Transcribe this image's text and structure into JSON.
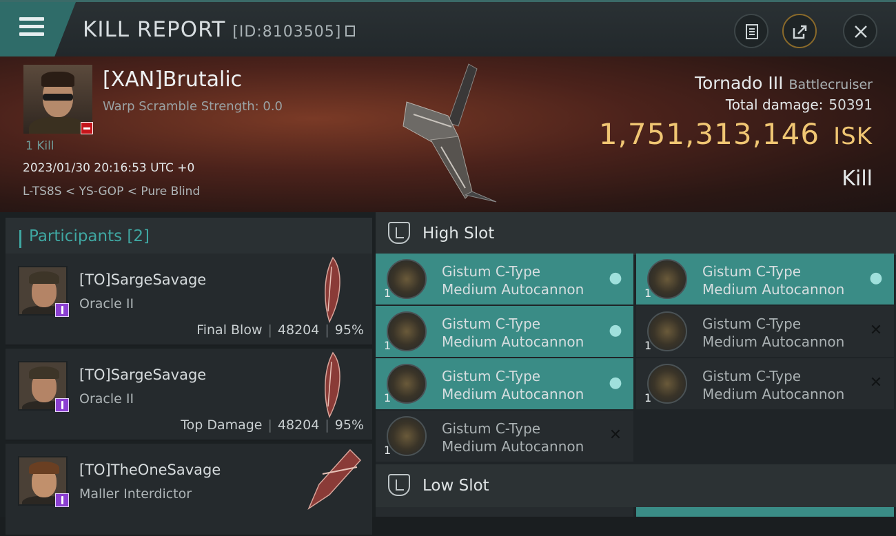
{
  "header": {
    "title": "KILL REPORT",
    "report_id": "[ID:8103505]"
  },
  "victim": {
    "name": "[XAN]Brutalic",
    "warp_scramble": "Warp Scramble Strength: 0.0",
    "kills": "1 Kill",
    "timestamp": "2023/01/30 20:16:53 UTC +0",
    "location": "L-TS8S < YS-GOP < Pure Blind",
    "ship_name": "Tornado III",
    "ship_class": "Battlecruiser",
    "total_damage_label": "Total damage:",
    "total_damage_value": "50391",
    "isk_value": "1,751,313,146",
    "isk_unit": "ISK",
    "result": "Kill"
  },
  "participants": {
    "title": "Participants",
    "count": "[2]",
    "rows": [
      {
        "name": "[TO]SargeSavage",
        "ship": "Oracle II",
        "label": "Final Blow",
        "damage": "48204",
        "percent": "95%"
      },
      {
        "name": "[TO]SargeSavage",
        "ship": "Oracle II",
        "label": "Top Damage",
        "damage": "48204",
        "percent": "95%"
      },
      {
        "name": "[TO]TheOneSavage",
        "ship": "Maller Interdictor",
        "label": "",
        "damage": "",
        "percent": ""
      }
    ]
  },
  "fitting": {
    "high_slot_title": "High Slot",
    "low_slot_title": "Low Slot",
    "modules": [
      {
        "qty": "1",
        "line1": "Gistum C-Type",
        "line2": "Medium Autocannon",
        "status": "dropped"
      },
      {
        "qty": "1",
        "line1": "Gistum C-Type",
        "line2": "Medium Autocannon",
        "status": "dropped"
      },
      {
        "qty": "1",
        "line1": "Gistum C-Type",
        "line2": "Medium Autocannon",
        "status": "dropped"
      },
      {
        "qty": "1",
        "line1": "Gistum C-Type",
        "line2": "Medium Autocannon",
        "status": "destroyed"
      },
      {
        "qty": "1",
        "line1": "Gistum C-Type",
        "line2": "Medium Autocannon",
        "status": "dropped"
      },
      {
        "qty": "1",
        "line1": "Gistum C-Type",
        "line2": "Medium Autocannon",
        "status": "destroyed"
      },
      {
        "qty": "1",
        "line1": "Gistum C-Type",
        "line2": "Medium Autocannon",
        "status": "destroyed"
      }
    ]
  },
  "icons": {
    "menu": "hamburger-icon",
    "copy": "copy-icon",
    "clipboard": "clipboard-icon",
    "share": "share-icon",
    "close": "close-icon",
    "dropped": "person-icon",
    "destroyed": "x-icon"
  },
  "colors": {
    "accent": "#3fa7a2",
    "isk": "#f0c673",
    "dropped_bg": "#3a8c86",
    "destroyed_bg": "#262b2e",
    "corp_badge": "#8b3fd1",
    "warning_badge": "#c4151b"
  }
}
